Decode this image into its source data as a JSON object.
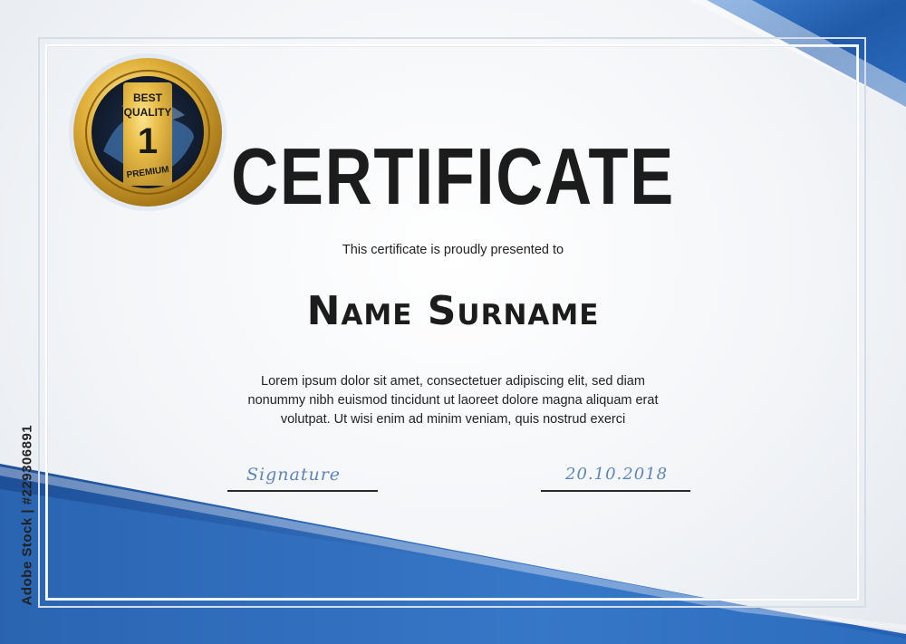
{
  "certificate": {
    "title": "CERTIFICATE",
    "presented_text": "This certificate is proudly presented to",
    "recipient_name": "Name Surname",
    "body_text": "Lorem ipsum dolor sit amet, consectetuer adipiscing elit, sed diam nonummy nibh euismod tincidunt ut laoreet dolore magna aliquam erat volutpat. Ut wisi enim ad minim veniam, quis nostrud exerci",
    "signature_label": "Signature",
    "date_label": "20.10.2018"
  },
  "medal": {
    "top_text": "BEST",
    "middle_text": "QUALITY",
    "number": "1",
    "bottom_text": "PREMIUM"
  },
  "stock_id": "Adobe Stock | #229306891",
  "colors": {
    "accent_blue": "#2a63b0",
    "gold": "#d9a92b",
    "text_dark": "#1c1c1c",
    "signature_blue": "#5f85b8"
  }
}
